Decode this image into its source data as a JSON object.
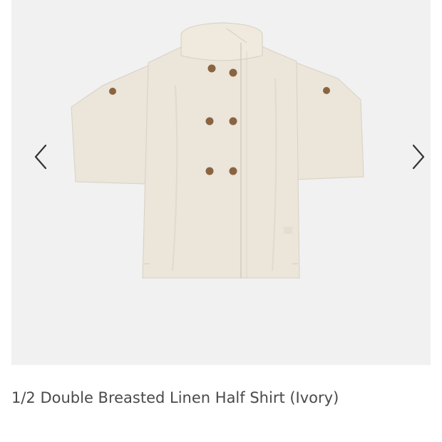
{
  "product": {
    "title": "1/2 Double Breasted Linen Half Shirt (Ivory)",
    "image_subject": "ivory linen half-sleeve double breasted shirt with brown buttons"
  },
  "carousel": {
    "prev_icon": "chevron-left-icon",
    "next_icon": "chevron-right-icon"
  },
  "colors": {
    "image_background": "#f1f1f1",
    "shirt": "#ebe5da",
    "shirt_shade": "#ded7ca",
    "button": "#8a6440",
    "text": "#4a4a4a",
    "arrow": "#333333"
  }
}
